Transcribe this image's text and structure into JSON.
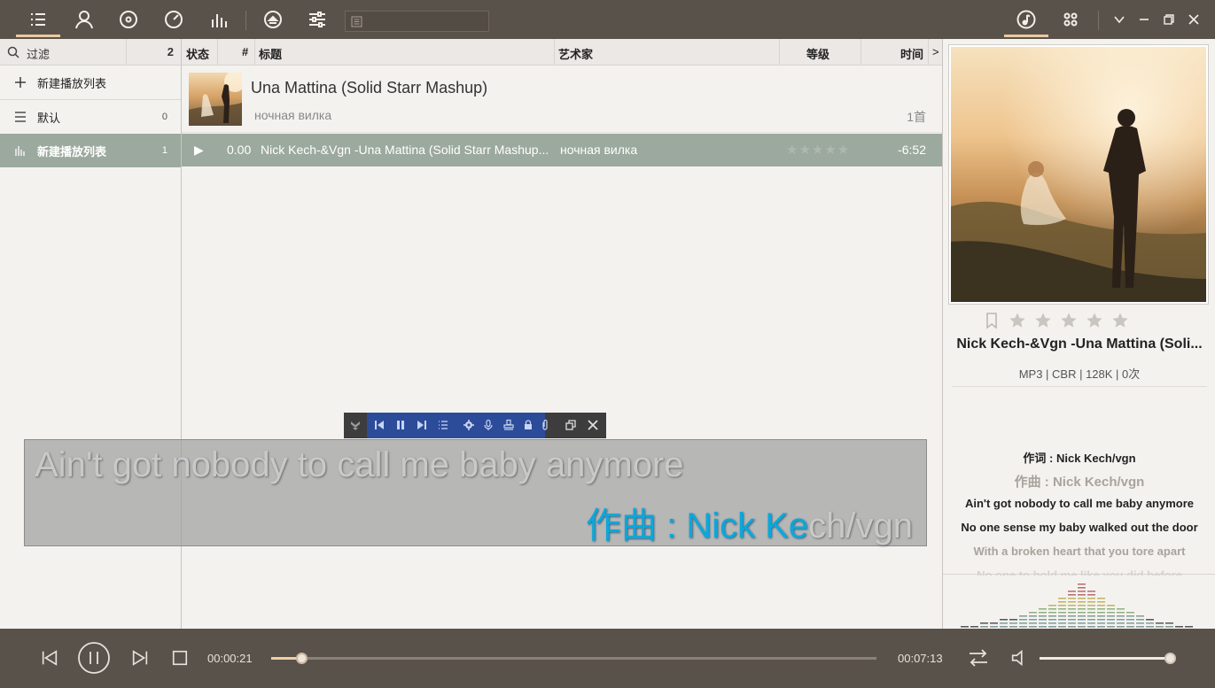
{
  "colors": {
    "bar_bg": "#59524a",
    "accent": "#e9c9a2",
    "selection": "#9ca99e",
    "lyric_highlight": "#0aa8dc"
  },
  "top_nav_icons": [
    "playlist-icon",
    "artist-icon",
    "album-icon",
    "disc-icon",
    "equalizer-bars-icon",
    "eject-icon",
    "sliders-icon"
  ],
  "sidebar": {
    "filter_label": "过滤",
    "filter_count": "2",
    "new_playlist_label": "新建播放列表",
    "items": [
      {
        "label": "默认",
        "count": "0"
      },
      {
        "label": "新建播放列表",
        "count": "1"
      }
    ]
  },
  "columns": {
    "status": "状态",
    "number": "#",
    "title": "标题",
    "artist": "艺术家",
    "rating": "等级",
    "time": "时间",
    "more": ">"
  },
  "group": {
    "title": "Una Mattina (Solid Starr Mashup)",
    "artist": "ночная вилка",
    "count": "1首"
  },
  "track": {
    "number": "0.00",
    "title": "Nick Kech-&Vgn -Una Mattina (Solid Starr Mashup...",
    "artist": "ночная вилка",
    "rating_stars": "★★★★★",
    "time": "-6:52"
  },
  "now_playing": {
    "title": "Nick Kech-&Vgn -Una Mattina (Soli...",
    "meta": "MP3 | CBR | 128K | 0次",
    "rating": 0,
    "rating_max": 5
  },
  "lyrics_panel": [
    {
      "text": "作词 : Nick Kech/vgn",
      "color": "#222222"
    },
    {
      "text": "作曲 : Nick Kech/vgn",
      "color": "#a8a39c"
    },
    {
      "text": "Ain't got nobody to call me baby anymore",
      "color": "#222222"
    },
    {
      "text": "No one sense my baby walked out the door",
      "color": "#222222"
    },
    {
      "text": "With a broken heart that you tore apart",
      "color": "#a8a39c"
    },
    {
      "text": "No one to hold me like you did before",
      "color": "#d6d2cc"
    }
  ],
  "desktop_lyrics": {
    "line1": "Ain't got nobody to call me baby anymore",
    "line2_sung": "作曲 : Nick Ke",
    "line2_rest": "ch/vgn",
    "karaoke_progress": 0.62
  },
  "player": {
    "elapsed": "00:00:21",
    "total": "00:07:13",
    "progress": 0.05,
    "volume": 1.0
  }
}
